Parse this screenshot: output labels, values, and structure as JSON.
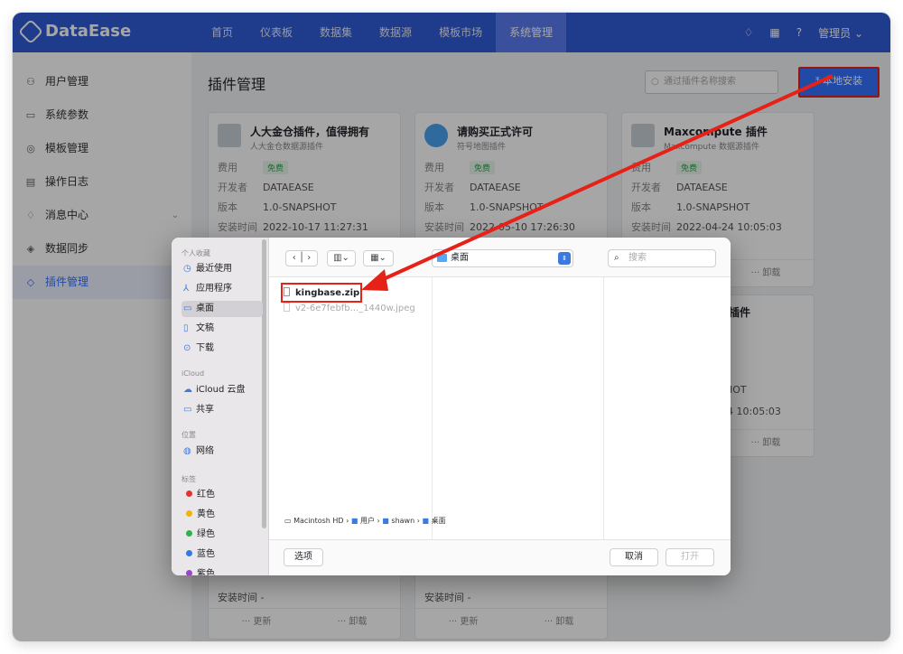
{
  "app": {
    "name": "DataEase"
  },
  "nav": [
    "首页",
    "仪表板",
    "数据集",
    "数据源",
    "模板市场",
    "系统管理"
  ],
  "header": {
    "user": "管理员"
  },
  "sidebar": [
    {
      "icon": "users-icon",
      "glyph": "⚇",
      "label": "用户管理"
    },
    {
      "icon": "monitor-icon",
      "glyph": "▭",
      "label": "系统参数"
    },
    {
      "icon": "template-icon",
      "glyph": "◎",
      "label": "模板管理"
    },
    {
      "icon": "log-icon",
      "glyph": "▤",
      "label": "操作日志"
    },
    {
      "icon": "bell-icon",
      "glyph": "♢",
      "label": "消息中心"
    },
    {
      "icon": "sync-icon",
      "glyph": "◈",
      "label": "数据同步"
    },
    {
      "icon": "plugin-icon",
      "glyph": "◇",
      "label": "插件管理"
    }
  ],
  "page": {
    "title": "插件管理",
    "search_placeholder": "通过插件名称搜索",
    "install_label": "本地安装"
  },
  "labels": {
    "fee": "费用",
    "developer": "开发者",
    "version": "版本",
    "install_time": "安装时间",
    "update": "··· 更新",
    "uninstall": "··· 卸载"
  },
  "cards": [
    {
      "name": "人大金仓插件，值得拥有",
      "desc": "人大金仓数据源插件",
      "fee": "免费",
      "developer": "DATAEASE",
      "version": "1.0-SNAPSHOT",
      "time": "2022-10-17 11:27:31"
    },
    {
      "name": "请购买正式许可",
      "desc": "符号地图插件",
      "fee": "免费",
      "developer": "DATAEASE",
      "version": "1.0-SNAPSHOT",
      "time": "2022-05-10 17:26:30"
    },
    {
      "name": "Maxcompute 插件",
      "desc": "Maxcompute 数据源插件",
      "fee": "免费",
      "developer": "DATAEASE",
      "version": "1.0-SNAPSHOT",
      "time": "2022-04-24 10:05:03"
    }
  ],
  "partial": {
    "name_tail": "插件",
    "version_tail": "HOT",
    "time_tail": "4 10:05:03",
    "time_label": "安装时间 -"
  },
  "dialog": {
    "sections": {
      "favorites": "个人收藏",
      "icloud": "iCloud",
      "locations": "位置",
      "tags": "标签"
    },
    "favorites": [
      "最近使用",
      "应用程序",
      "桌面",
      "文稿",
      "下载"
    ],
    "icloud": [
      "iCloud 云盘",
      "共享"
    ],
    "locations": [
      "网络"
    ],
    "tags": [
      {
        "label": "红色",
        "color": "#e8322e"
      },
      {
        "label": "黄色",
        "color": "#f5b400"
      },
      {
        "label": "绿色",
        "color": "#2cb34a"
      },
      {
        "label": "蓝色",
        "color": "#2f7ae5"
      },
      {
        "label": "紫色",
        "color": "#9b44c9"
      }
    ],
    "location": "桌面",
    "search_placeholder": "搜索",
    "files": [
      "kingbase.zip",
      "v2-6e7febfb..._1440w.jpeg"
    ],
    "path": [
      "Macintosh HD",
      "用户",
      "shawn",
      "桌面"
    ],
    "options_label": "选项",
    "cancel_label": "取消",
    "open_label": "打开"
  }
}
